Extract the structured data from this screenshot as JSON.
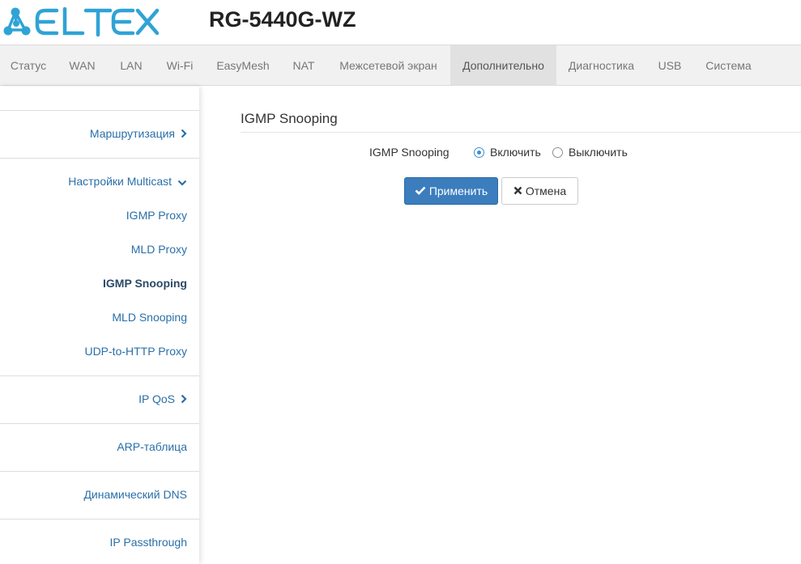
{
  "header": {
    "logo_text": "ELTEX",
    "model": "RG-5440G-WZ",
    "brand_color": "#2fa3d6"
  },
  "topnav": {
    "items": [
      {
        "label": "Статус"
      },
      {
        "label": "WAN"
      },
      {
        "label": "LAN"
      },
      {
        "label": "Wi-Fi"
      },
      {
        "label": "EasyMesh"
      },
      {
        "label": "NAT"
      },
      {
        "label": "Межсетевой экран"
      },
      {
        "label": "Дополнительно",
        "active": true
      },
      {
        "label": "Диагностика"
      },
      {
        "label": "USB"
      },
      {
        "label": "Система"
      }
    ]
  },
  "sidebar": {
    "items": [
      {
        "label": "Маршрутизация",
        "icon": "chevron-right-icon"
      },
      {
        "label": "Настройки Multicast",
        "icon": "chevron-down-icon"
      },
      {
        "label": "IGMP Proxy"
      },
      {
        "label": "MLD Proxy"
      },
      {
        "label": "IGMP Snooping",
        "current": true
      },
      {
        "label": "MLD Snooping"
      },
      {
        "label": "UDP-to-HTTP Proxy"
      },
      {
        "label": "IP QoS",
        "icon": "chevron-right-icon"
      },
      {
        "label": "ARP-таблица"
      },
      {
        "label": "Динамический DNS"
      },
      {
        "label": "IP Passthrough"
      }
    ]
  },
  "main": {
    "title": "IGMP Snooping",
    "field_label": "IGMP Snooping",
    "options": [
      {
        "label": "Включить",
        "checked": true
      },
      {
        "label": "Выключить",
        "checked": false
      }
    ],
    "apply_label": "Применить",
    "apply_icon": "check-icon",
    "cancel_label": "Отмена",
    "cancel_icon": "close-icon"
  },
  "colors": {
    "link": "#2a6fa8",
    "primary_button": "#3b7dbd",
    "radio_accent": "#3c8fd0",
    "nav_active_bg": "#e1e1e1"
  }
}
